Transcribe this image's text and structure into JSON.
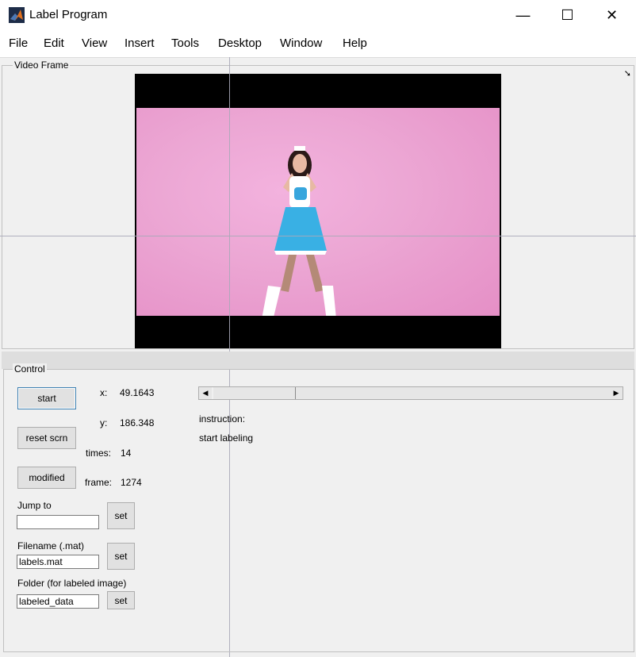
{
  "window": {
    "title": "Label Program",
    "minimize": "—",
    "maximize": "☐",
    "close": "✕"
  },
  "menu": [
    "File",
    "Edit",
    "View",
    "Insert",
    "Tools",
    "Desktop",
    "Window",
    "Help"
  ],
  "video_panel": {
    "title": "Video Frame"
  },
  "control": {
    "title": "Control",
    "start_button": "start",
    "reset_button": "reset scrn",
    "modified_button": "modified",
    "x_label": "x:",
    "x_value": "49.1643",
    "y_label": "y:",
    "y_value": "186.348",
    "times_label": "times:",
    "times_value": "14",
    "frame_label": "frame:",
    "frame_value": "1274",
    "instruction_label": "instruction:",
    "instruction_value": "start labeling",
    "jump_label": "Jump to",
    "jump_value": "",
    "jump_set": "set",
    "filename_label": "Filename (.mat)",
    "filename_value": "labels.mat",
    "filename_set": "set",
    "folder_label": "Folder (for labeled image)",
    "folder_value": "labeled_data",
    "folder_set": "set",
    "slider_left_arrow": "◀",
    "slider_right_arrow": "▶"
  },
  "colors": {
    "background": "#f0f0f0",
    "video_pink": "#eca7d4",
    "matlab_icon": "#e0701e"
  }
}
